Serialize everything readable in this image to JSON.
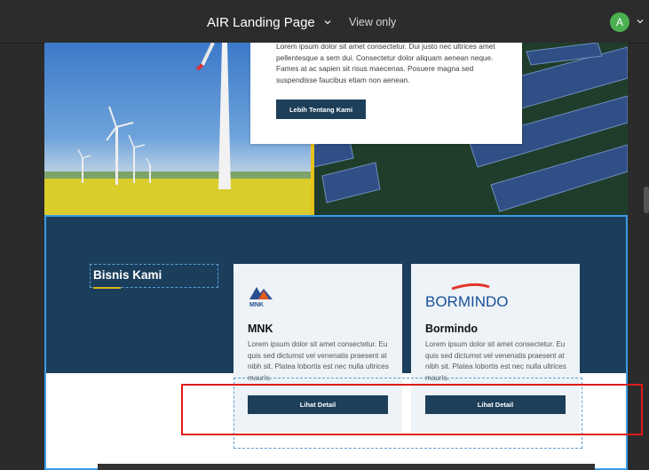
{
  "topbar": {
    "title": "AIR Landing Page",
    "view_mode": "View only",
    "avatar_initial": "A"
  },
  "about": {
    "text": "Lorem ipsum dolor sit amet consectetur. Dui justo nec ultrices amet pellentesque a sem dui. Consectetur dolor aliquam aenean neque. Fames at ac sapien sit risus maecenas. Posuere magna sed suspendisse faucibus etiam non aenean.",
    "button": "Lebih Tentang Kami"
  },
  "business": {
    "title": "Bisnis Kami",
    "cards": [
      {
        "logo_text": "MNK",
        "title": "MNK",
        "text": "Lorem ipsum dolor sit amet consectetur. Eu quis sed dictumst vel venenatis praesent at nibh sit. Platea lobortis est nec nulla ultrices mauris.",
        "button": "Lihat Detail"
      },
      {
        "logo_text": "BORMINDO",
        "title": "Bormindo",
        "text": "Lorem ipsum dolor sit amet consectetur. Eu quis sed dictumst vel venenatis praesent at nibh sit. Platea lobortis est nec nulla ultrices mauris.",
        "button": "Lihat Detail"
      }
    ]
  },
  "colors": {
    "navy": "#1a3e5b",
    "button": "#1d3f5a",
    "accent": "#e0b21c",
    "selection": "#3b9be6",
    "highlight": "#e01b1b"
  }
}
